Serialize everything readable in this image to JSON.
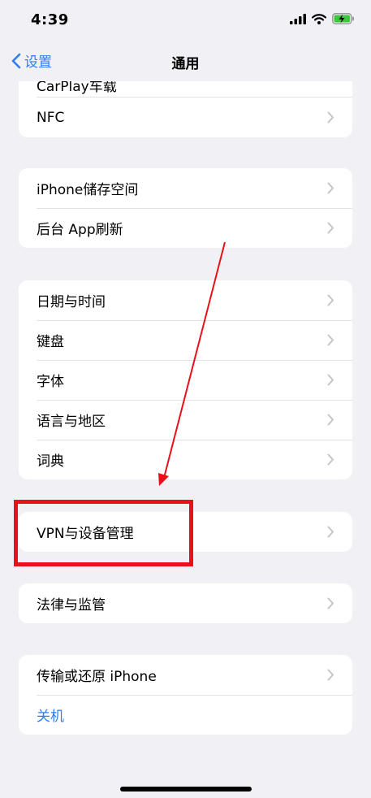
{
  "status": {
    "time": "4:39"
  },
  "nav": {
    "back_label": "设置",
    "title": "通用"
  },
  "groups": [
    {
      "items": [
        "NFC"
      ]
    },
    {
      "items": [
        "iPhone储存空间",
        "后台 App刷新"
      ]
    },
    {
      "items": [
        "日期与时间",
        "键盘",
        "字体",
        "语言与地区",
        "词典"
      ]
    },
    {
      "items": [
        "VPN与设备管理"
      ]
    },
    {
      "items": [
        "法律与监管"
      ]
    },
    {
      "items": [
        "传输或还原 iPhone",
        "关机"
      ]
    }
  ],
  "partial_row": "CarPlay车载",
  "annotation": {
    "color": "#e8101b",
    "highlighted_item": "VPN与设备管理"
  },
  "colors": {
    "accent": "#2f7cf6",
    "background": "#f1f1f5"
  }
}
